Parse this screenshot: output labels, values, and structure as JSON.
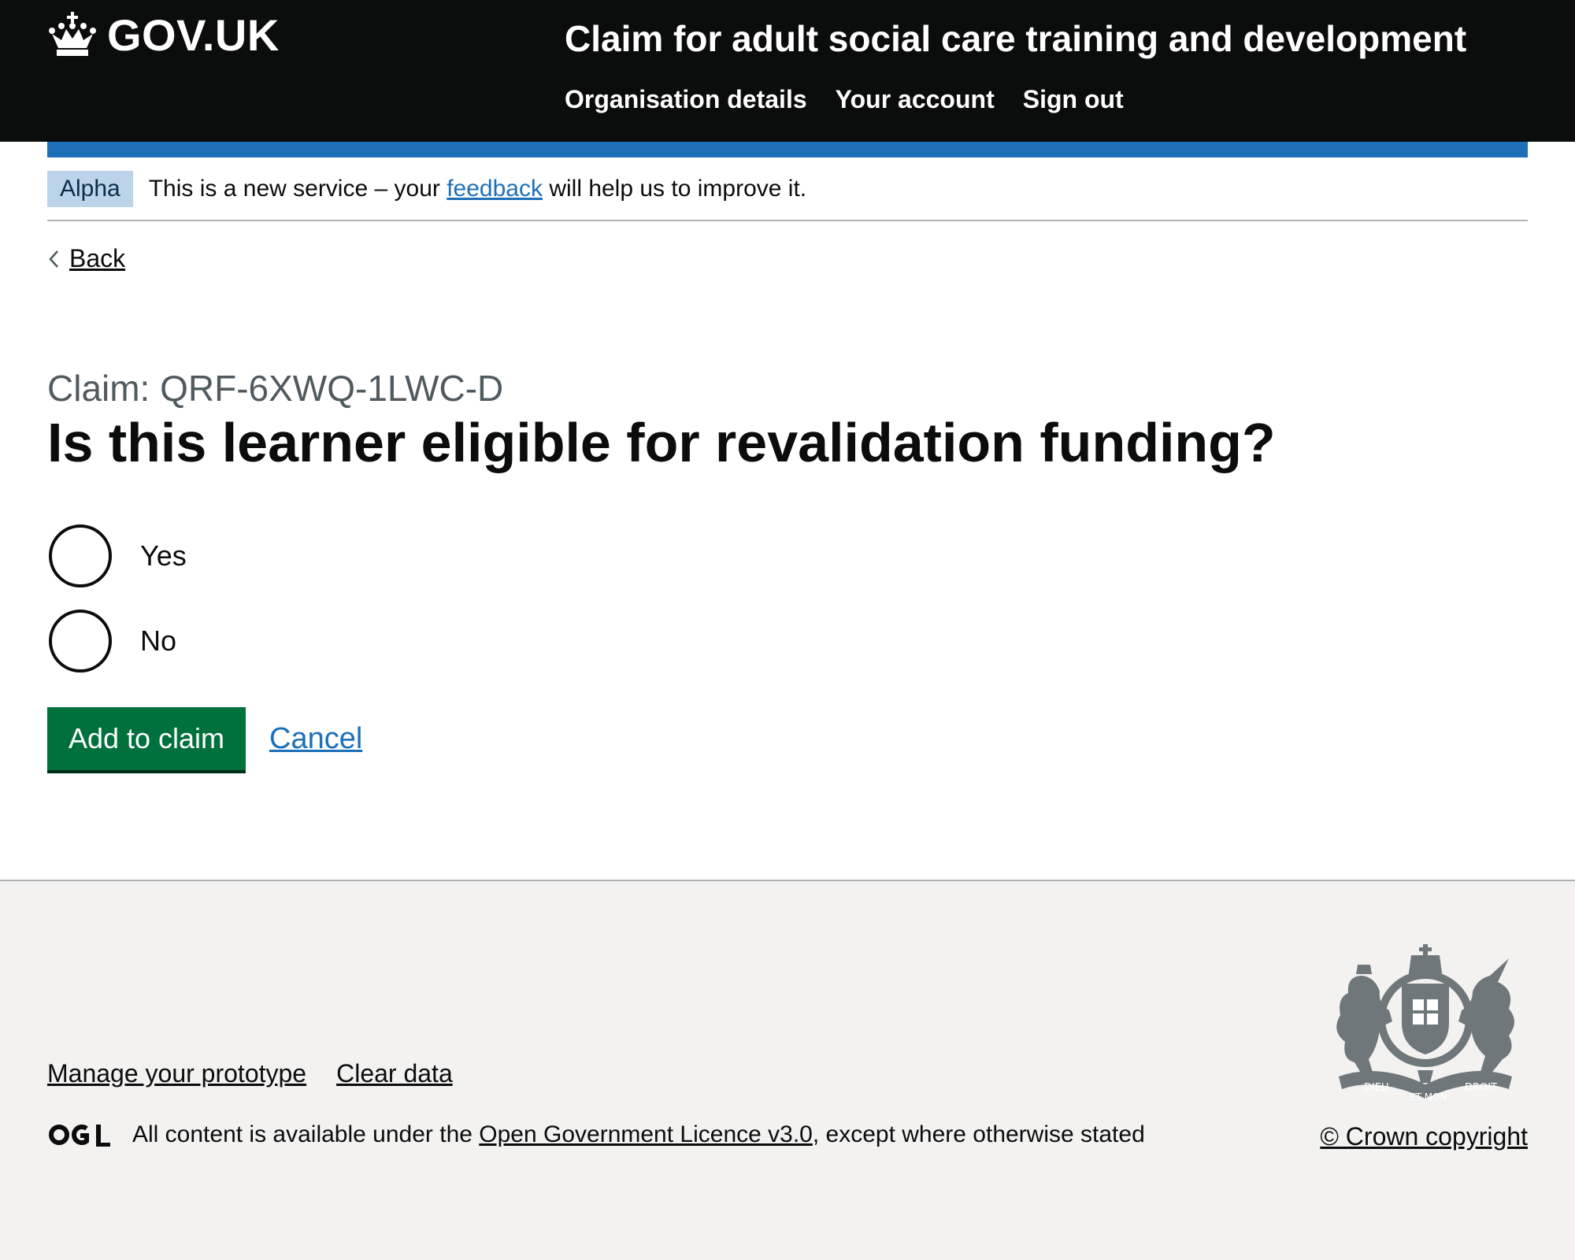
{
  "header": {
    "logo_text": "GOV.UK",
    "service_name": "Claim for adult social care training and development",
    "nav": [
      "Organisation details",
      "Your account",
      "Sign out"
    ]
  },
  "phase_banner": {
    "tag": "Alpha",
    "text_before": "This is a new service – your ",
    "link": "feedback",
    "text_after": " will help us to improve it."
  },
  "back_link": "Back",
  "main": {
    "caption": "Claim: QRF-6XWQ-1LWC-D",
    "heading": "Is this learner eligible for revalidation funding?",
    "options": [
      "Yes",
      "No"
    ],
    "submit_label": "Add to claim",
    "cancel_label": "Cancel"
  },
  "footer": {
    "links": [
      "Manage your prototype",
      "Clear data"
    ],
    "licence_before": "All content is available under the ",
    "licence_link": "Open Government Licence v3.0",
    "licence_after": ", except where otherwise stated",
    "copyright": "© Crown copyright",
    "crest_motto": [
      "DIEU",
      "ET MON",
      "DROIT"
    ]
  },
  "colors": {
    "header_bg": "#0b0c0c",
    "brand_blue": "#1d70b8",
    "button_green": "#00703c",
    "footer_bg": "#f3f2f1"
  },
  "icons": [
    "crown-icon",
    "chevron-left-icon",
    "ogl-logo-icon",
    "royal-crest-icon"
  ]
}
